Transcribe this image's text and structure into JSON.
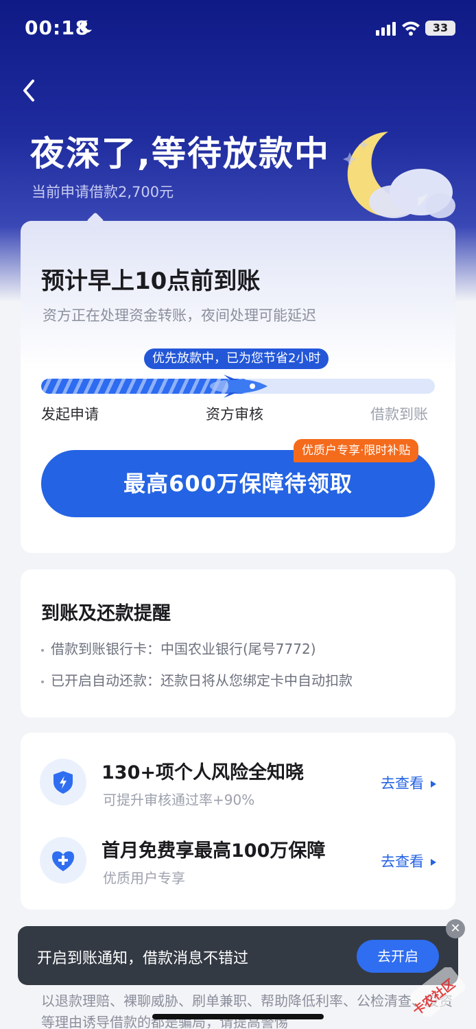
{
  "status_bar": {
    "time": "00:18",
    "battery": "33",
    "icons": [
      "moon-icon",
      "signal-icon",
      "wifi-icon",
      "battery-icon"
    ]
  },
  "header": {
    "back_icon": "chevron-left-icon",
    "title": "夜深了,等待放款中",
    "subtitle": "当前申请借款2,700元"
  },
  "progress_card": {
    "title": "预计早上10点前到账",
    "description": "资方正在处理资金转账，夜间处理可能延迟",
    "tip": "优先放款中，已为您节省2小时",
    "progress": 0.53,
    "steps": [
      {
        "label": "发起申请",
        "state": "done"
      },
      {
        "label": "资方审核",
        "state": "current"
      },
      {
        "label": "借款到账",
        "state": "pending"
      }
    ],
    "promo_tag": "优质户专享·限时补贴",
    "cta_label": "最高600万保障待领取"
  },
  "reminder_card": {
    "title": "到账及还款提醒",
    "items": [
      "借款到账银行卡：中国农业银行(尾号7772)",
      "已开启自动还款：还款日将从您绑定卡中自动扣款"
    ]
  },
  "services": [
    {
      "icon": "shield-lightning-icon",
      "title": "130+项个人风险全知晓",
      "subtitle": "可提升审核通过率+90%",
      "link": "去查看"
    },
    {
      "icon": "heart-plus-icon",
      "title": "首月免费享最高100万保障",
      "subtitle": "优质用户专享",
      "link": "去查看"
    }
  ],
  "warning_text": "以退款理赔、裸聊威胁、刷单兼职、帮助降低利率、公检清查、投资等理由诱导借款的都是骗局，请提高警惕",
  "toast": {
    "text": "开启到账通知，借款消息不错过",
    "button": "去开启",
    "close": "✕"
  },
  "watermark": "卡农社区",
  "colors": {
    "brand_blue": "#2463e3",
    "hero_navy": "#0f1a86",
    "promo_orange": "#f46b1c"
  }
}
